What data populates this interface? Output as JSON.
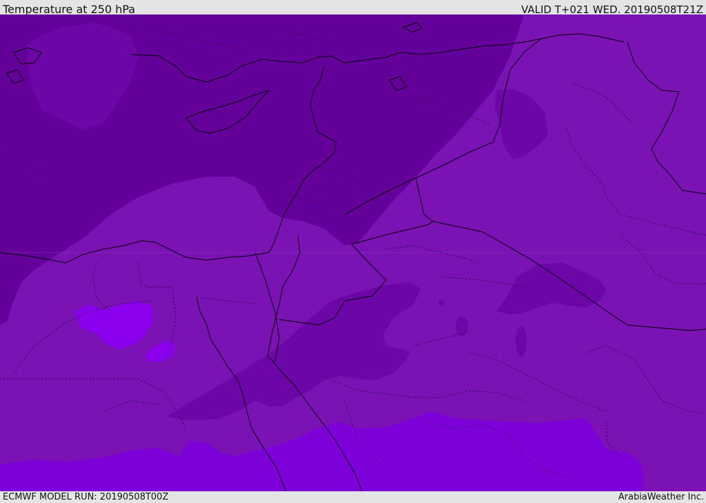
{
  "header": {
    "title": "Temperature at 250 hPa",
    "valid": "VALID T+021 WED. 20190508T21Z"
  },
  "footer": {
    "model_run": "ECMWF MODEL RUN: 20190508T00Z",
    "credit": "ArabiaWeather Inc."
  },
  "map": {
    "field": "temperature-250hPa",
    "colors": {
      "cold_deep": "#64009a",
      "cold_mid": "#6c06a6",
      "base": "#7a12b4",
      "warm": "#7e00d8",
      "warm_strong": "#8a00ee",
      "coastline": "#000000",
      "border": "#000000"
    }
  }
}
